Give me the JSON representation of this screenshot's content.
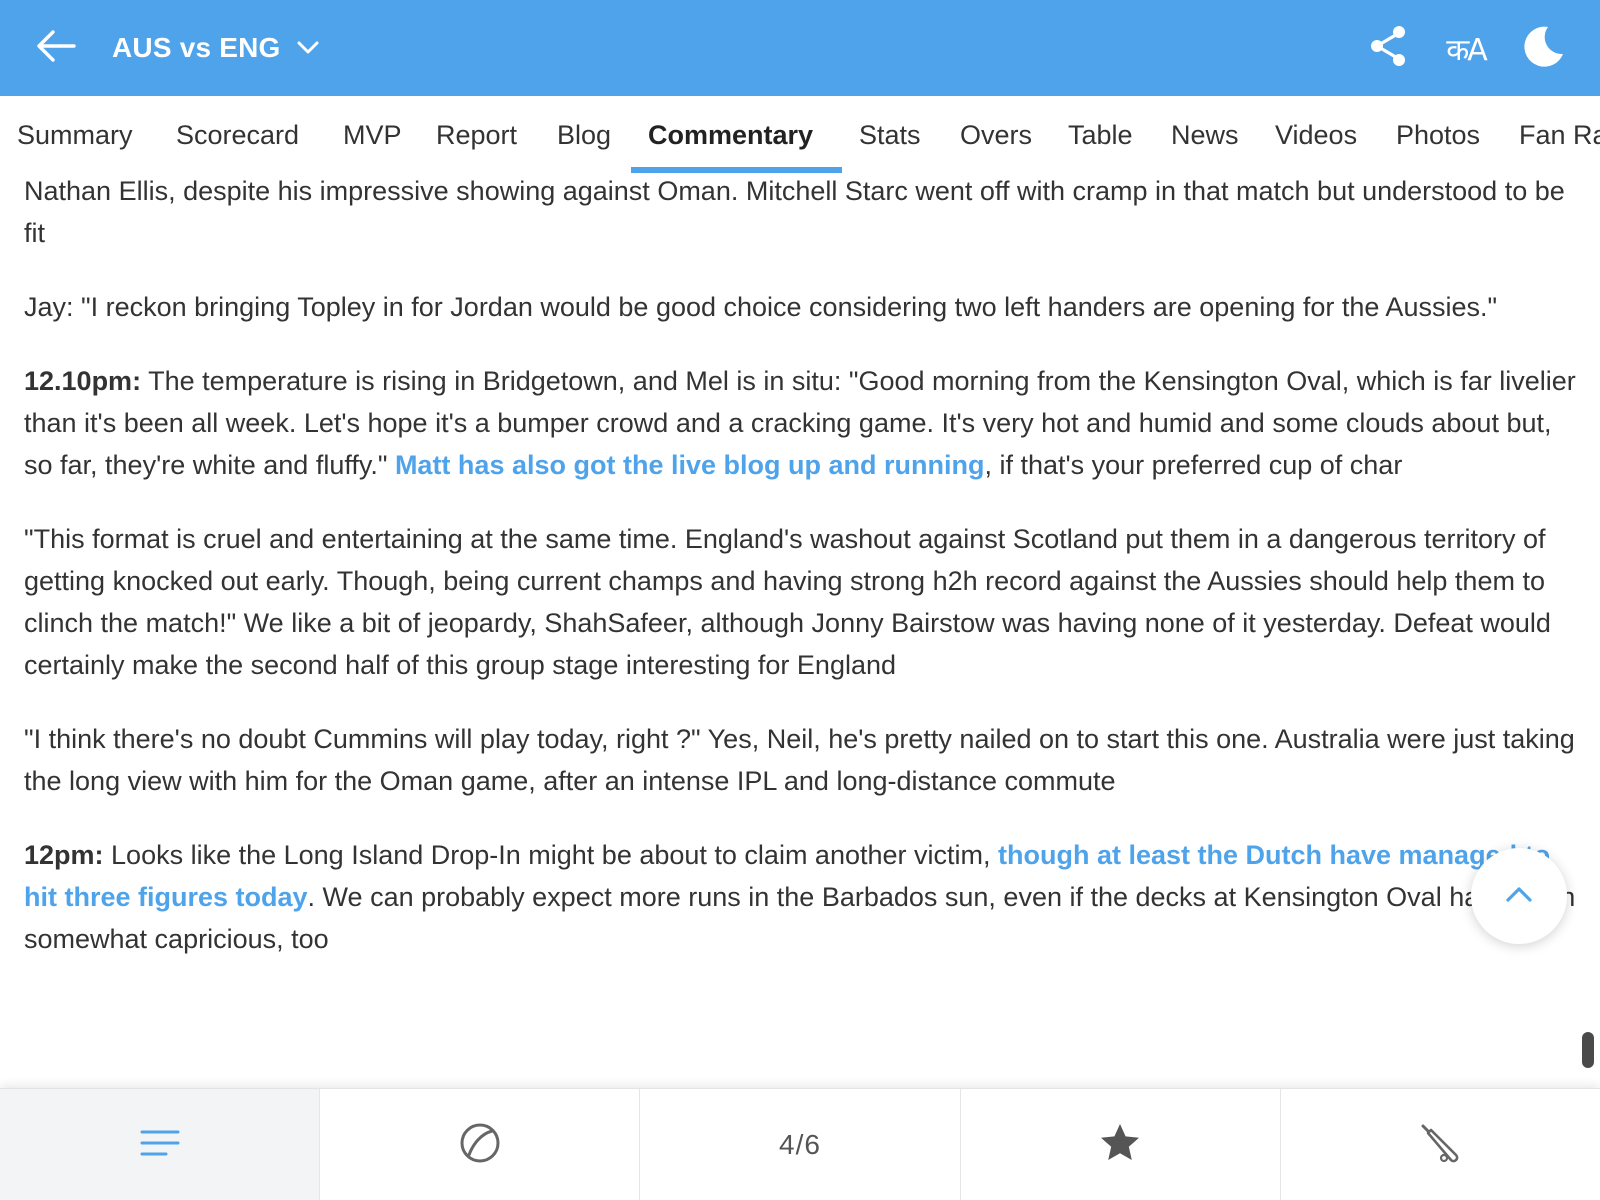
{
  "header": {
    "title": "AUS vs ENG",
    "colors": {
      "bar": "#4fa3ea",
      "text": "#ffffff"
    },
    "icons": [
      "back-arrow-icon",
      "chevron-down-icon",
      "share-icon",
      "language-icon",
      "night-mode-icon"
    ],
    "lang_label": "कA"
  },
  "tabs": [
    {
      "label": "Summary"
    },
    {
      "label": "Scorecard"
    },
    {
      "label": "MVP"
    },
    {
      "label": "Report"
    },
    {
      "label": "Blog"
    },
    {
      "label": "Commentary",
      "active": true
    },
    {
      "label": "Stats"
    },
    {
      "label": "Overs"
    },
    {
      "label": "Table"
    },
    {
      "label": "News"
    },
    {
      "label": "Videos"
    },
    {
      "label": "Photos"
    },
    {
      "label": "Fan Ra"
    }
  ],
  "commentary": [
    {
      "text": "Nathan Ellis, despite his impressive showing against Oman. Mitchell Starc went off with cramp in that match but understood to be fit"
    },
    {
      "text": "Jay: \"I reckon bringing Topley in for Jordan would be good choice considering two left handers are opening for the Aussies.\""
    },
    {
      "time": "12.10pm:",
      "text_before": " The temperature is rising in Bridgetown, and Mel is in situ: \"Good morning from the Kensington Oval, which is far livelier than it's been all week. Let's hope it's a bumper crowd and a cracking game. It's very hot and humid and some clouds about but, so far, they're white and fluffy.\" ",
      "link": "Matt has also got the live blog up and running",
      "text_after": ", if that's your preferred cup of char"
    },
    {
      "text": "\"This format is cruel and entertaining at the same time. England's washout against Scotland put them in a dangerous territory of getting knocked out early. Though, being current champs and having strong h2h record against the Aussies should help them to clinch the match!\" We like a bit of jeopardy, ShahSafeer, although Jonny Bairstow was having none of it yesterday. Defeat would certainly make the second half of this group stage interesting for England"
    },
    {
      "text": "\"I think there's no doubt Cummins will play today, right ?\" Yes, Neil, he's pretty nailed on to start this one. Australia were just taking the long view with him for the Oman game, after an intense IPL and long-distance commute"
    },
    {
      "time": "12pm:",
      "text_before": " Looks like the Long Island Drop-In might be about to claim another victim, ",
      "link": "though at least the Dutch have managed to hit three figures today",
      "text_after": ". We can probably expect more runs in the Barbados sun, even if the decks at Kensington Oval have been somewhat capricious, too"
    }
  ],
  "bottom_bar": {
    "icons": [
      "menu-lines-icon",
      "ball-icon",
      "star-icon",
      "bat-icon"
    ],
    "page_indicator": "4/6",
    "selected": "menu"
  }
}
